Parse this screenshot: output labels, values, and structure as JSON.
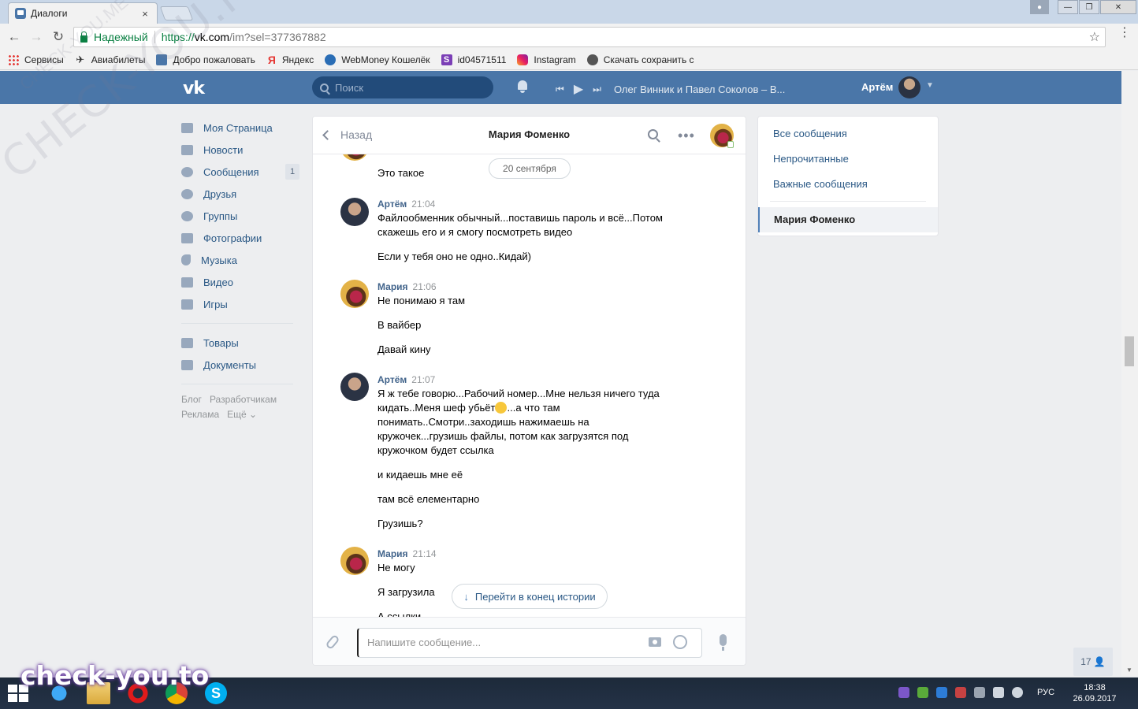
{
  "browser": {
    "tab_title": "Диалоги",
    "tab_close": "×",
    "secure_label": "Надежный",
    "url_proto": "https://",
    "url_host": "vk.com",
    "url_path": "/im?sel=377367882",
    "window_controls": [
      "—",
      "❐",
      "✕"
    ],
    "bookmarks": [
      {
        "label": "Сервисы",
        "icon": "apps-icon"
      },
      {
        "label": "Авиабилеты",
        "icon": "plane-icon"
      },
      {
        "label": "Добро пожаловать",
        "icon": "vk-icon"
      },
      {
        "label": "Яндекс",
        "icon": "yandex-icon"
      },
      {
        "label": "WebMoney Кошелёк",
        "icon": "webmoney-icon"
      },
      {
        "label": "id04571511",
        "icon": "s-icon"
      },
      {
        "label": "Instagram",
        "icon": "instagram-icon"
      },
      {
        "label": "Скачать сохранить с",
        "icon": "download-icon"
      }
    ]
  },
  "header": {
    "logo": "vk",
    "search_placeholder": "Поиск",
    "track": "Олег Винник и Павел Соколов – В...",
    "user_name": "Артём"
  },
  "left_nav": {
    "items": [
      {
        "label": "Моя Страница"
      },
      {
        "label": "Новости"
      },
      {
        "label": "Сообщения",
        "badge": "1"
      },
      {
        "label": "Друзья"
      },
      {
        "label": "Группы"
      },
      {
        "label": "Фотографии"
      },
      {
        "label": "Музыка"
      },
      {
        "label": "Видео"
      },
      {
        "label": "Игры"
      },
      {
        "label": "Товары"
      },
      {
        "label": "Документы"
      }
    ],
    "footer": [
      "Блог",
      "Разработчикам",
      "Реклама",
      "Ещё ⌄"
    ]
  },
  "chat": {
    "back_label": "Назад",
    "title": "Мария Фоменко",
    "date_pill": "20 сентября",
    "first_text": "Это такое",
    "groups": [
      {
        "author": "Артём",
        "time": "21:04",
        "lines": [
          "Файлообменник обычный...поставишь пароль и всё...Потом скажешь его и я смогу посмотреть видео",
          "Если у тебя оно не одно..Кидай)"
        ]
      },
      {
        "author": "Мария",
        "time": "21:06",
        "lines": [
          "Не понимаю я там",
          "В вайбер",
          "Давай кину"
        ]
      },
      {
        "author": "Артём",
        "time": "21:07",
        "lines": [
          "Я ж тебе говорю...Рабочий номер...Мне нельзя ничего туда кидать..Меня шеф убьёт",
          "...а что там понимать..Смотри..заходишь нажимаешь на кружочек...грузишь файлы, потом как загрузятся под кружочком будет ссылка",
          "и кидаешь мне её",
          "там всё елементарно",
          "Грузишь?"
        ]
      },
      {
        "author": "Мария",
        "time": "21:14",
        "lines": [
          "Не могу",
          "Я загрузила",
          "А ссылки"
        ]
      }
    ],
    "jump_label": "Перейти в конец истории",
    "input_placeholder": "Напишите сообщение..."
  },
  "right_panel": {
    "items": [
      "Все сообщения",
      "Непрочитанные",
      "Важные сообщения"
    ],
    "selected": "Мария Фоменко"
  },
  "online_counter": "17 👤",
  "taskbar": {
    "lang": "РУС",
    "time": "18:38",
    "date": "26.09.2017"
  },
  "watermarks": {
    "big": "CHECK-YOU.ME",
    "small": "CHECK-YOU.ME",
    "footer": "check-you.to"
  },
  "colors": {
    "vk_blue": "#4a76a8",
    "link": "#2a5885",
    "secure_green": "#0b8043"
  }
}
